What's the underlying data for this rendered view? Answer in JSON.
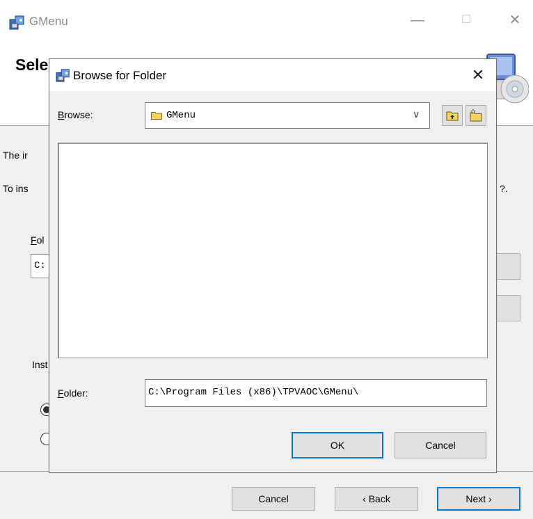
{
  "window": {
    "title": "GMenu",
    "minimize_glyph": "—",
    "maximize_glyph": "☐",
    "close_glyph": "✕",
    "app_icon": "installer-icon"
  },
  "header": {
    "title": "Select Installation Folder",
    "art_icon": "computer-cd-icon"
  },
  "main": {
    "text_line1": "The ir",
    "text_line2": "To ins",
    "text_line2_tail": "?.",
    "folder_label_prefix": "F",
    "folder_label_rest": "ol",
    "folder_value": "C:",
    "install_label": "Inst"
  },
  "dialog": {
    "title": "Browse for Folder",
    "icon": "installer-icon",
    "close_glyph": "✕",
    "browse_label_prefix": "B",
    "browse_label_rest": "rowse:",
    "browse_value": "GMenu",
    "combo_arrow": "∨",
    "up_folder_icon": "up-folder-icon",
    "new_folder_icon": "new-folder-icon",
    "folder_label_prefix": "F",
    "folder_label_rest": "older:",
    "folder_path": "C:\\Program Files (x86)\\TPVAOC\\GMenu\\",
    "ok_label": "OK",
    "cancel_label": "Cancel"
  },
  "bottom": {
    "cancel_label": "Cancel",
    "back_label": "‹ Back",
    "next_label": "Next ›"
  },
  "colors": {
    "accent": "#0078d7",
    "dialog_bg": "#f0f0f0",
    "button_bg": "#e1e1e1"
  }
}
